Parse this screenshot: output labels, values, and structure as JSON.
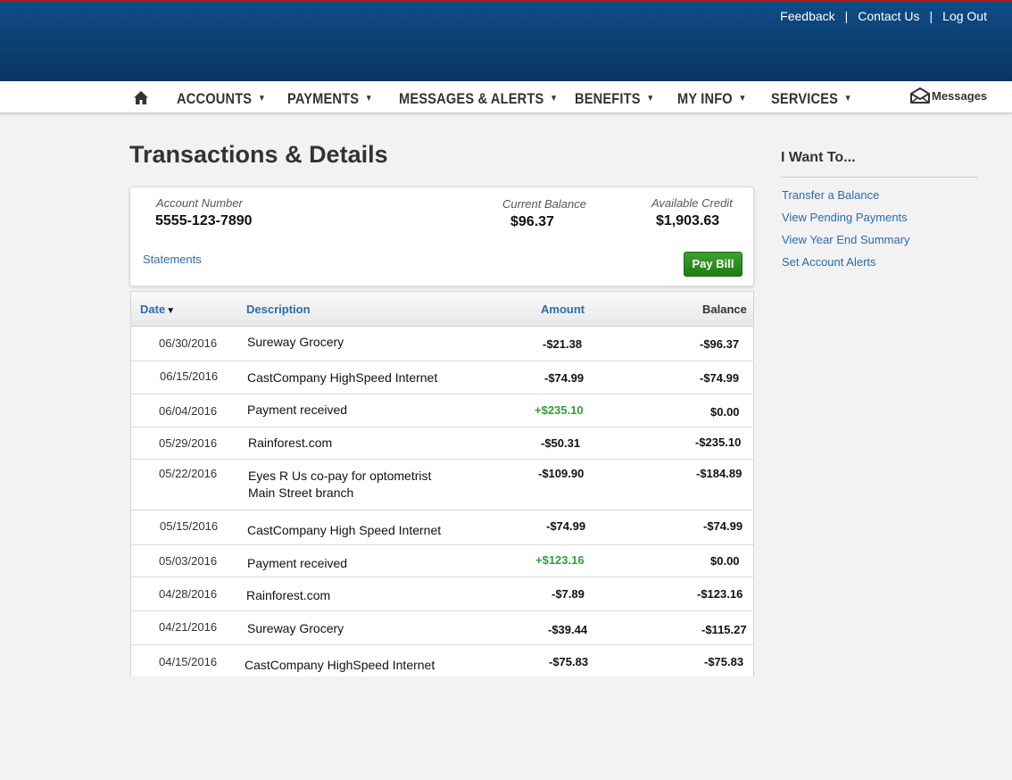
{
  "header": {
    "links": {
      "feedback": "Feedback",
      "contact": "Contact Us",
      "logout": "Log Out",
      "separator": "|"
    }
  },
  "nav": {
    "home_icon": "home-icon",
    "caret": "▼",
    "items": [
      "ACCOUNTS",
      "PAYMENTS",
      "MESSAGES & ALERTS",
      "BENEFITS",
      "MY INFO",
      "SERVICES"
    ],
    "messages_icon": "envelope-icon",
    "messages_label": "Messages"
  },
  "page": {
    "title": "Transactions & Details"
  },
  "summary": {
    "account_number_label": "Account Number",
    "account_number": "5555-123-7890",
    "current_balance_label": "Current Balance",
    "current_balance": "$96.37",
    "available_credit_label": "Available Credit",
    "available_credit": "$1,903.63",
    "statements_link": "Statements",
    "pay_bill_button": "Pay Bill"
  },
  "table": {
    "headers": {
      "date": "Date",
      "sort_indicator": "▼",
      "description": "Description",
      "amount": "Amount",
      "balance": "Balance"
    },
    "rows": [
      {
        "date": "06/30/2016",
        "description": "Sureway Grocery",
        "amount": "-$21.38",
        "balance": "-$96.37"
      },
      {
        "date": "06/15/2016",
        "description": "CastCompany HighSpeed Internet",
        "amount": "-$74.99",
        "balance": "-$74.99"
      },
      {
        "date": "06/04/2016",
        "description": "Payment received",
        "amount": "+$235.10",
        "balance": "$0.00"
      },
      {
        "date": "05/29/2016",
        "description": "Rainforest.com",
        "amount": "-$50.31",
        "balance": "-$235.10"
      },
      {
        "date": "05/22/2016",
        "description": "Eyes R Us co-pay for optometrist",
        "description2": "Main Street branch",
        "amount": "-$109.90",
        "balance": "-$184.89"
      },
      {
        "date": "05/15/2016",
        "description": "CastCompany High Speed Internet",
        "amount": "-$74.99",
        "balance": "-$74.99"
      },
      {
        "date": "05/03/2016",
        "description": "Payment received",
        "amount": "+$123.16",
        "balance": "$0.00"
      },
      {
        "date": "04/28/2016",
        "description": "Rainforest.com",
        "amount": "-$7.89",
        "balance": "-$123.16"
      },
      {
        "date": "04/21/2016",
        "description": "Sureway Grocery",
        "amount": "-$39.44",
        "balance": "-$115.27"
      },
      {
        "date": "04/15/2016",
        "description": "CastCompany HighSpeed Internet",
        "amount": "-$75.83",
        "balance": "-$75.83"
      }
    ]
  },
  "sidebar": {
    "title": "I Want To...",
    "links": [
      "Transfer a Balance",
      "View Pending Payments",
      "View Year End Summary",
      "Set Account Alerts"
    ]
  },
  "colors": {
    "header_blue": "#0f4c86",
    "header_accent_red": "#b01a1a",
    "link_blue": "#2a6cb0",
    "positive_green": "#2ea03a",
    "button_green": "#2a8f22"
  }
}
